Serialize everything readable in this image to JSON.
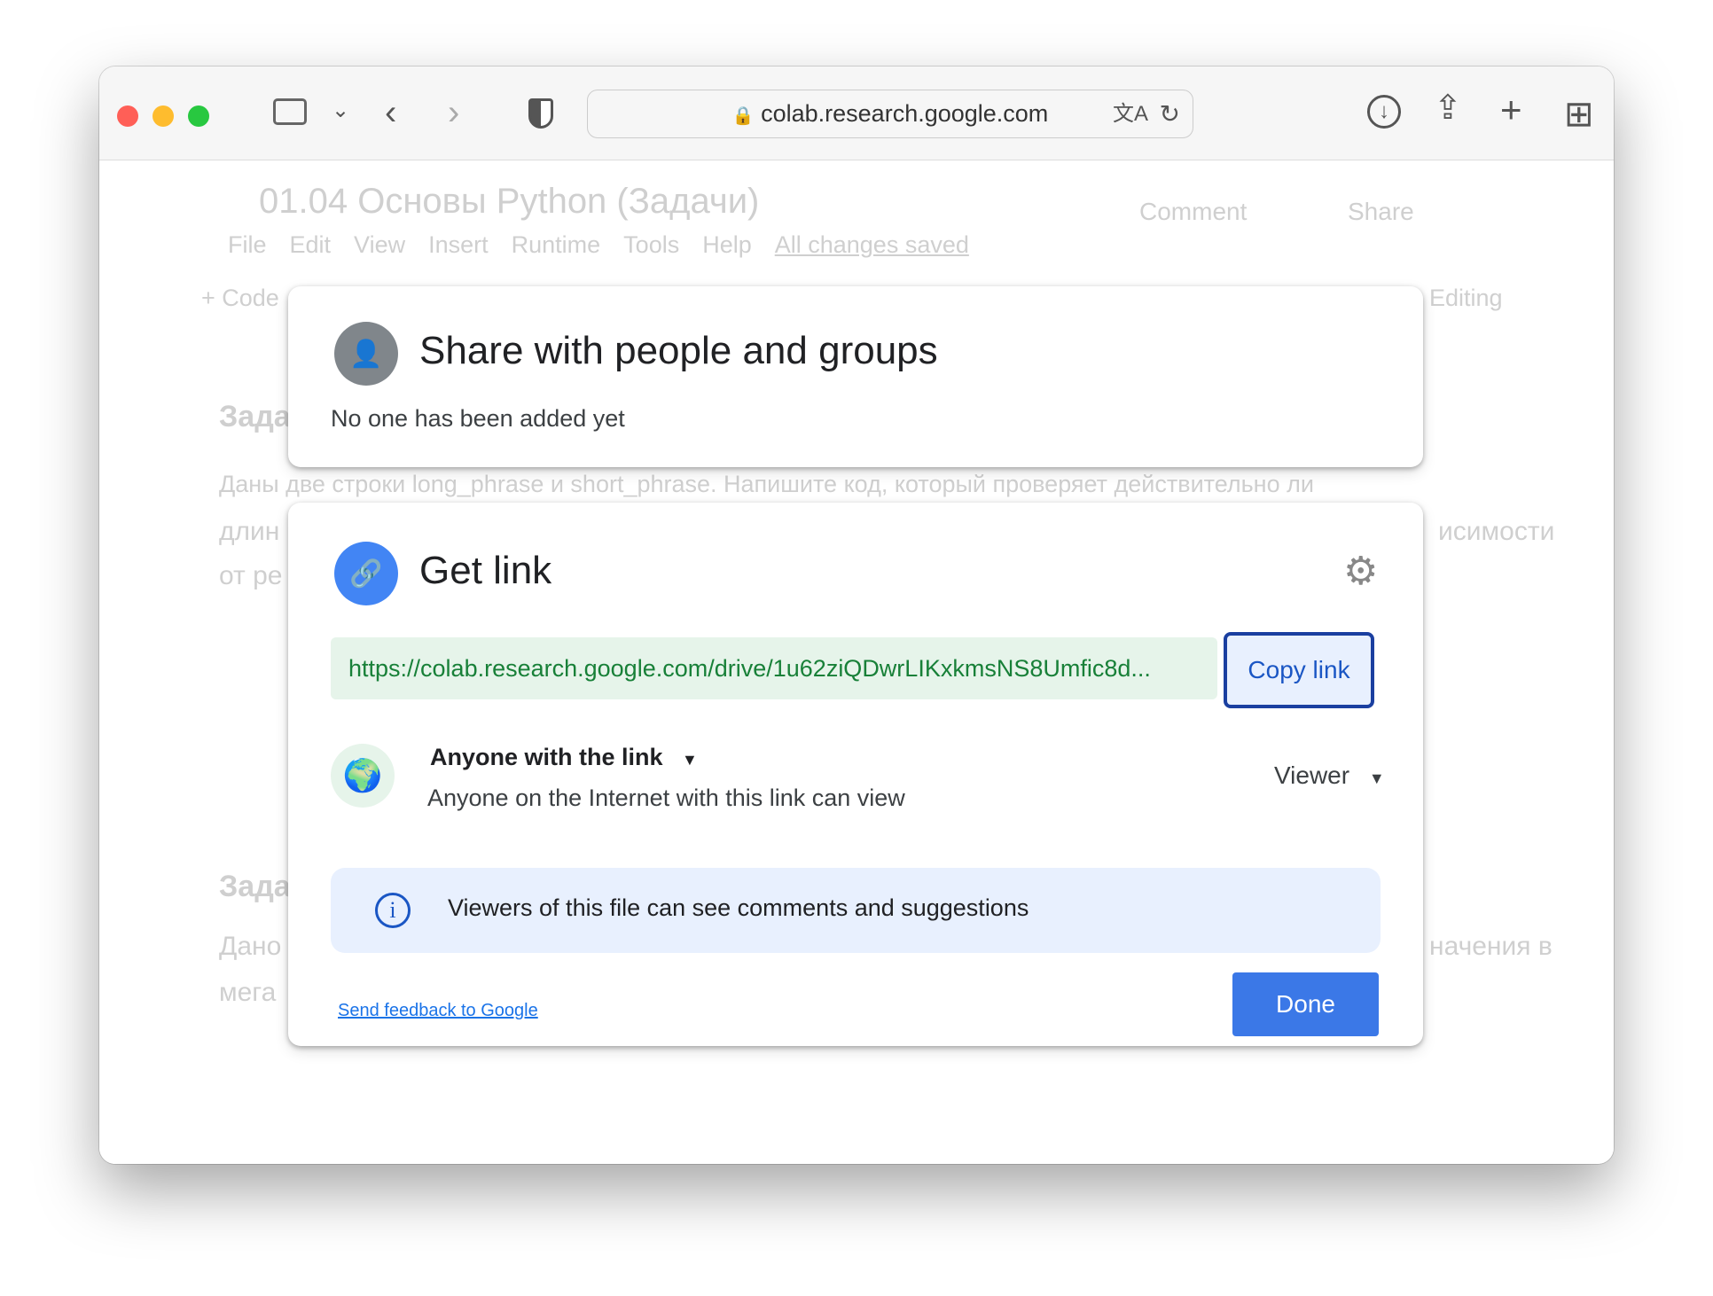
{
  "browser": {
    "url": "colab.research.google.com",
    "colors": {
      "close": "#ff5f57",
      "minimize": "#febc2e",
      "zoom": "#28c840"
    }
  },
  "colab": {
    "notebook_title": "01.04 Основы Python (Задачи)",
    "menu": [
      "File",
      "Edit",
      "View",
      "Insert",
      "Runtime",
      "Tools",
      "Help"
    ],
    "save_status": "All changes saved",
    "comment": "Comment",
    "share": "Share",
    "add_code": "+ Code",
    "editing": "Editing",
    "task_heading": "Зада",
    "para1a": "Даны две строки long_phrase и short_phrase. Напишите код, который проверяет действительно ли",
    "para1b": "длин",
    "para1c": "от ре",
    "para1d": "исимости",
    "task_heading2": "Зада",
    "para2a": "Дано",
    "para2b": "мега",
    "para2c": "начения в"
  },
  "share_dialog": {
    "title": "Share with people and groups",
    "subtitle": "No one has been added yet"
  },
  "link_dialog": {
    "title": "Get link",
    "url": "https://colab.research.google.com/drive/1u62ziQDwrLIKxkmsNS8Umfic8d...",
    "copy_label": "Copy link",
    "access": "Anyone with the link",
    "access_desc": "Anyone on the Internet with this link can view",
    "role": "Viewer",
    "info": "Viewers of this file can see comments and suggestions",
    "feedback": "Send feedback to Google",
    "done": "Done",
    "colors": {
      "accent": "#1a73e8",
      "url_bg": "#e6f4ea",
      "url_text": "#188038",
      "info_bg": "#e8f0fe"
    }
  }
}
